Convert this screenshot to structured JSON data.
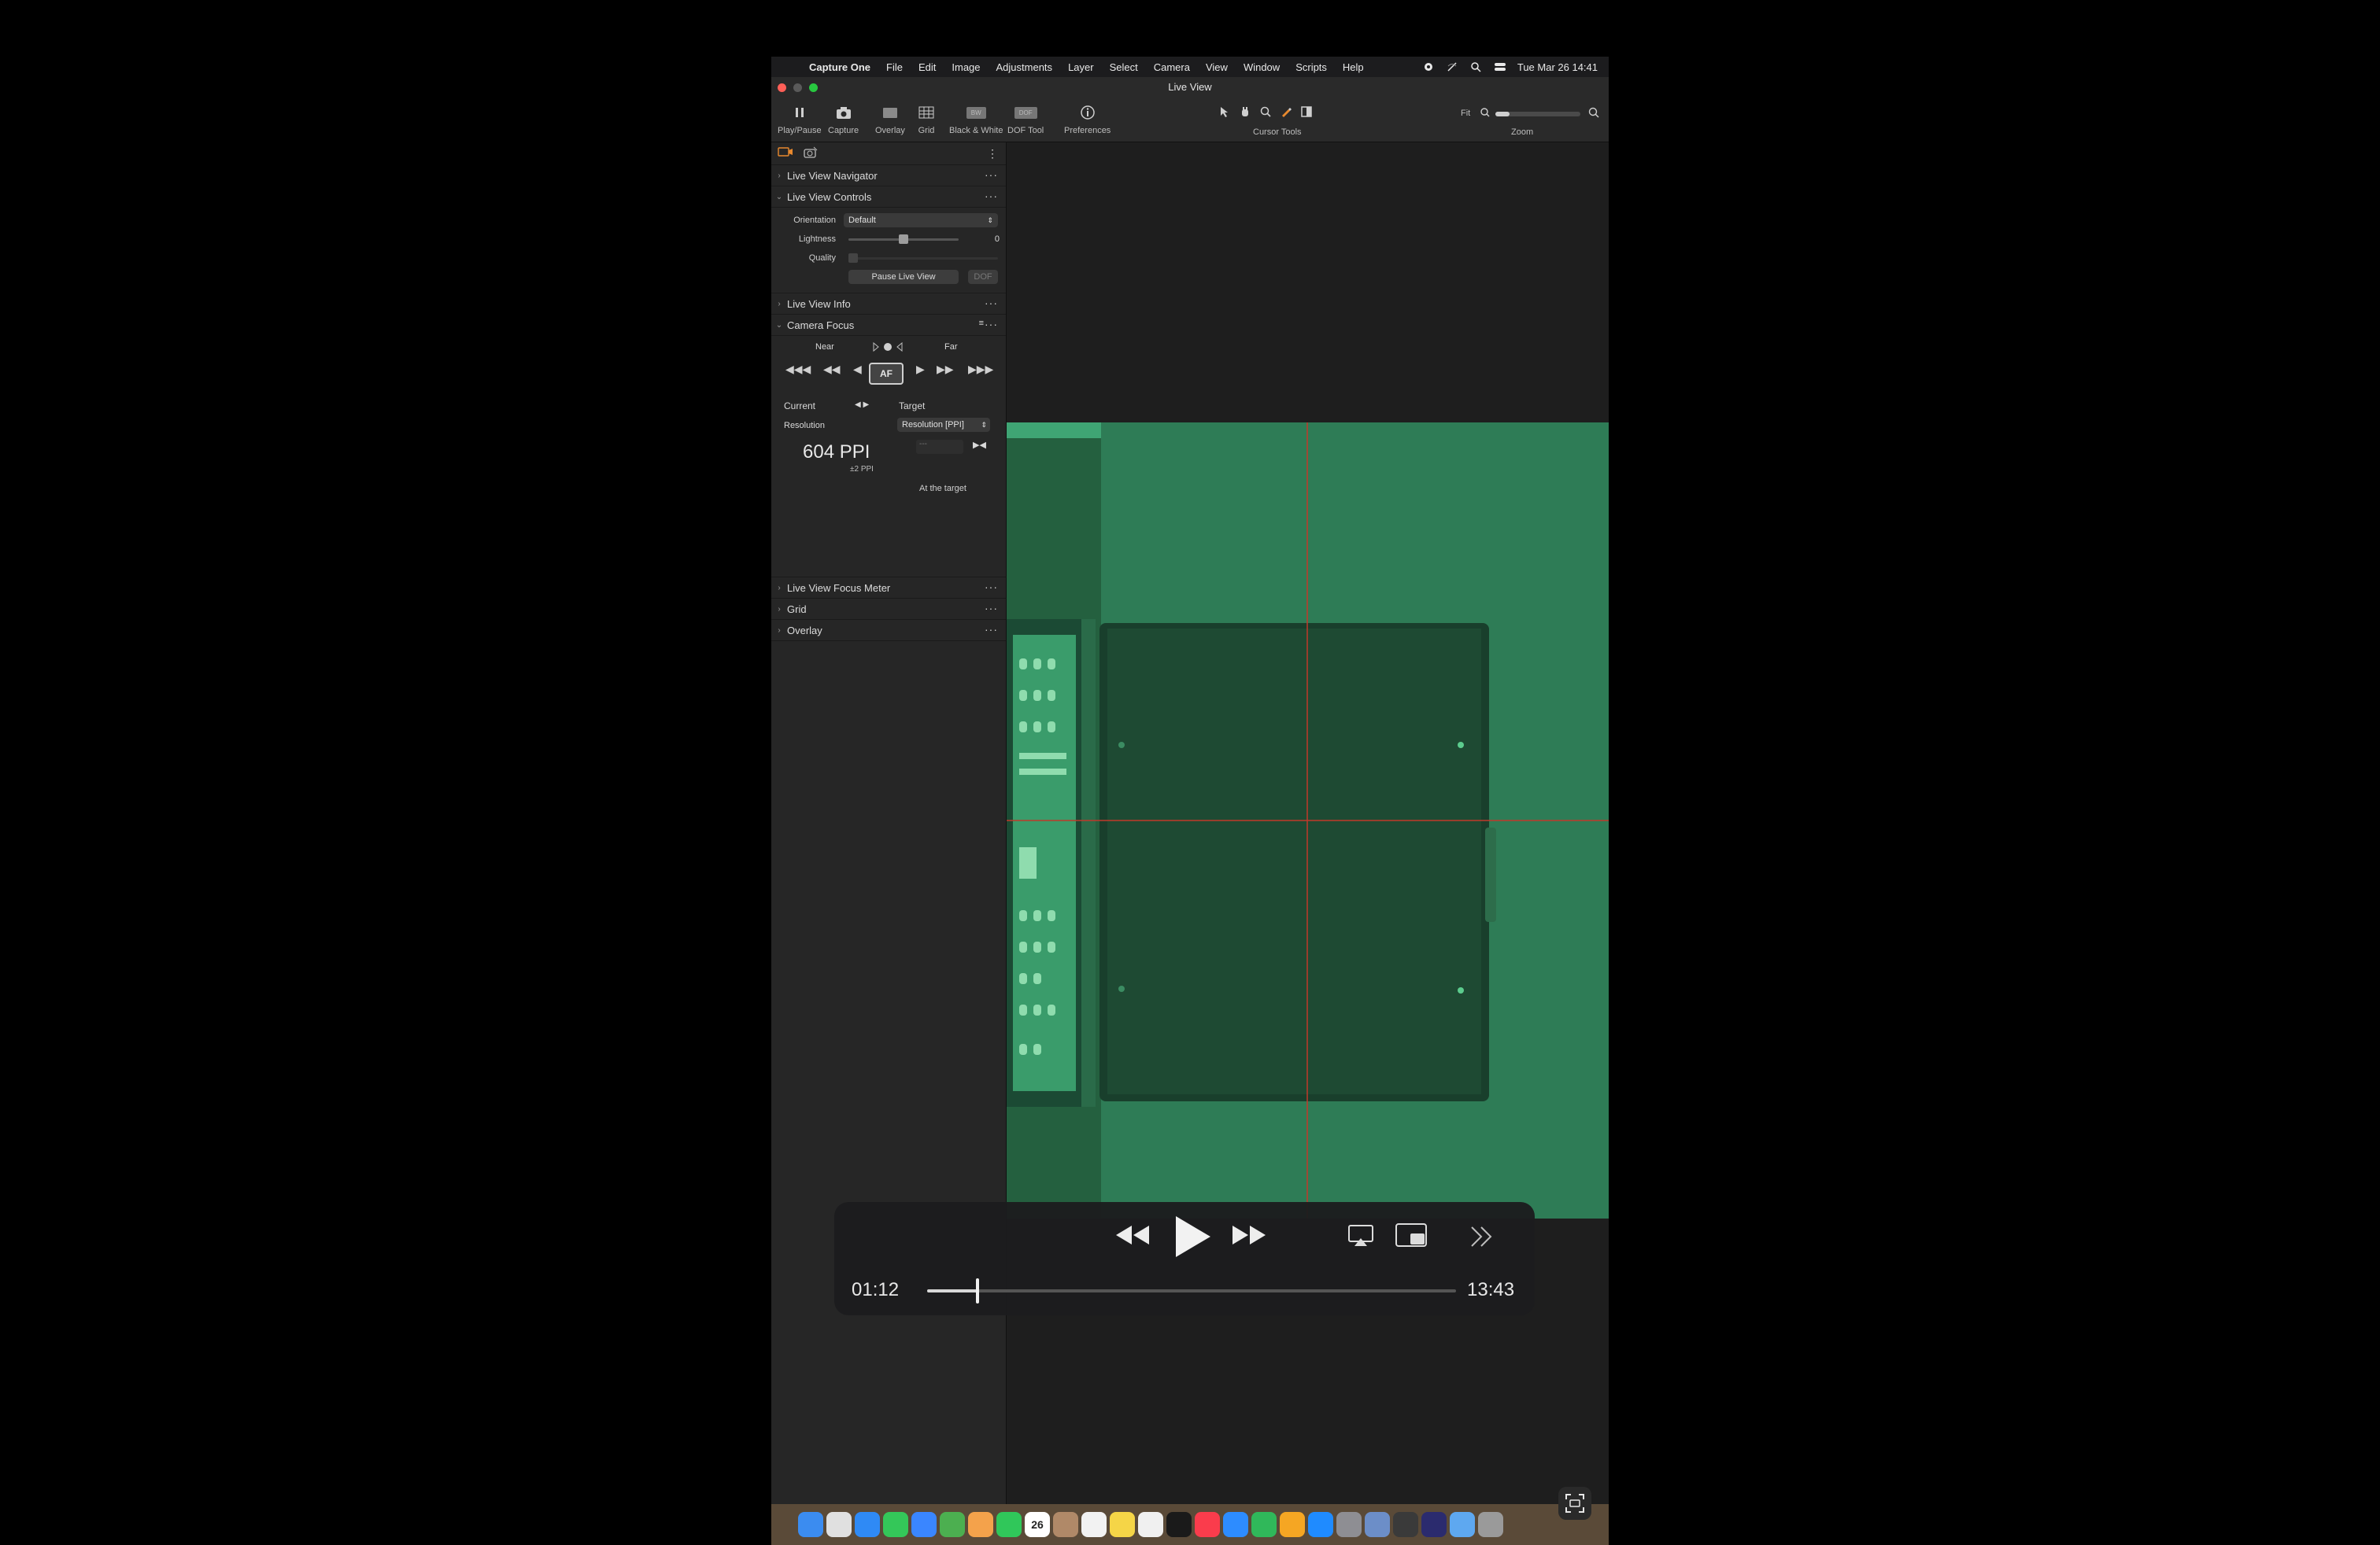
{
  "menubar": {
    "items": [
      "Capture One",
      "File",
      "Edit",
      "Image",
      "Adjustments",
      "Layer",
      "Select",
      "Camera",
      "View",
      "Window",
      "Scripts",
      "Help"
    ],
    "datetime": "Tue Mar 26  14:41"
  },
  "window": {
    "title": "Live View"
  },
  "toolbar": {
    "tools": [
      {
        "label": "Play/Pause",
        "icon": "pause-icon"
      },
      {
        "label": "Capture",
        "icon": "camera-icon"
      },
      {
        "label": "Overlay",
        "icon": "overlay-icon"
      },
      {
        "label": "Grid",
        "icon": "grid-icon"
      },
      {
        "label": "Black & White",
        "icon": "black-white-icon",
        "badge": "BW"
      },
      {
        "label": "DOF Tool",
        "icon": "dof-icon",
        "badge": "DOF"
      },
      {
        "label": "Preferences",
        "icon": "info-icon"
      }
    ],
    "cursor_tools_label": "Cursor Tools",
    "fit_label": "Fit",
    "zoom_label": "Zoom"
  },
  "panel": {
    "sections": {
      "navigator": "Live View Navigator",
      "controls": "Live View Controls",
      "info": "Live View Info",
      "focus": "Camera Focus",
      "focus_meter": "Live View Focus Meter",
      "grid": "Grid",
      "overlay": "Overlay"
    },
    "controls": {
      "orientation_label": "Orientation",
      "orientation_value": "Default",
      "lightness_label": "Lightness",
      "lightness_value": "0",
      "quality_label": "Quality",
      "pause_button": "Pause Live View",
      "dof_button": "DOF"
    },
    "focus": {
      "near": "Near",
      "far": "Far",
      "af": "AF",
      "current": "Current",
      "target": "Target",
      "resolution_label": "Resolution",
      "resolution_select": "Resolution [PPI]",
      "ppi_value": "604 PPI",
      "ppi_tolerance": "±2 PPI",
      "target_input": "---",
      "status": "At the target"
    }
  },
  "player": {
    "elapsed": "01:12",
    "remaining": "13:43",
    "progress": 0.095
  },
  "dock": {
    "apps": [
      "finder-icon",
      "launchpad-icon",
      "safari-icon",
      "messages-icon",
      "mail-icon",
      "maps-icon",
      "photos-icon",
      "facetime-icon",
      "calendar-icon",
      "contacts-icon",
      "reminders-icon",
      "notes-icon",
      "freeform-icon",
      "tv-icon",
      "music-icon",
      "keynote-icon",
      "numbers-icon",
      "pages-icon",
      "appstore-icon",
      "settings-icon",
      "preview-icon",
      "quicktime-icon",
      "capture-one-icon",
      "downloads-icon",
      "trash-icon"
    ],
    "calendar_day": "26"
  }
}
